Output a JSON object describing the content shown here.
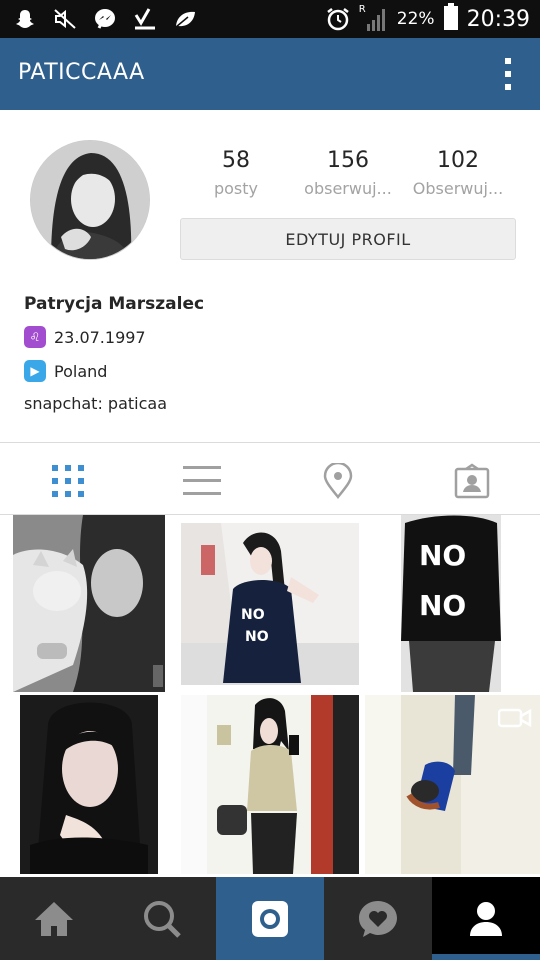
{
  "status_bar": {
    "battery": "22%",
    "time": "20:39",
    "signal_letter": "R"
  },
  "header": {
    "username": "PATICCAAA"
  },
  "profile": {
    "stats": [
      {
        "value": "58",
        "label": "posty"
      },
      {
        "value": "156",
        "label": "obserwuj..."
      },
      {
        "value": "102",
        "label": "Obserwuj..."
      }
    ],
    "edit_button": "EDYTUJ PROFIL",
    "name": "Patrycja Marszalec",
    "birthdate": "23.07.1997",
    "country": "Poland",
    "snapchat": "snapchat: paticaa"
  },
  "colors": {
    "accent": "#2f5f8c",
    "tab_active": "#3d8fd1",
    "tab_inactive": "#a0a0a0"
  },
  "tabs": [
    {
      "icon": "grid-icon",
      "active": true
    },
    {
      "icon": "list-icon",
      "active": false
    },
    {
      "icon": "location-pin-icon",
      "active": false
    },
    {
      "icon": "tagged-user-icon",
      "active": false
    }
  ],
  "bottom_nav": [
    {
      "icon": "home-icon"
    },
    {
      "icon": "search-icon"
    },
    {
      "icon": "camera-icon"
    },
    {
      "icon": "activity-heart-icon"
    },
    {
      "icon": "profile-icon"
    }
  ]
}
